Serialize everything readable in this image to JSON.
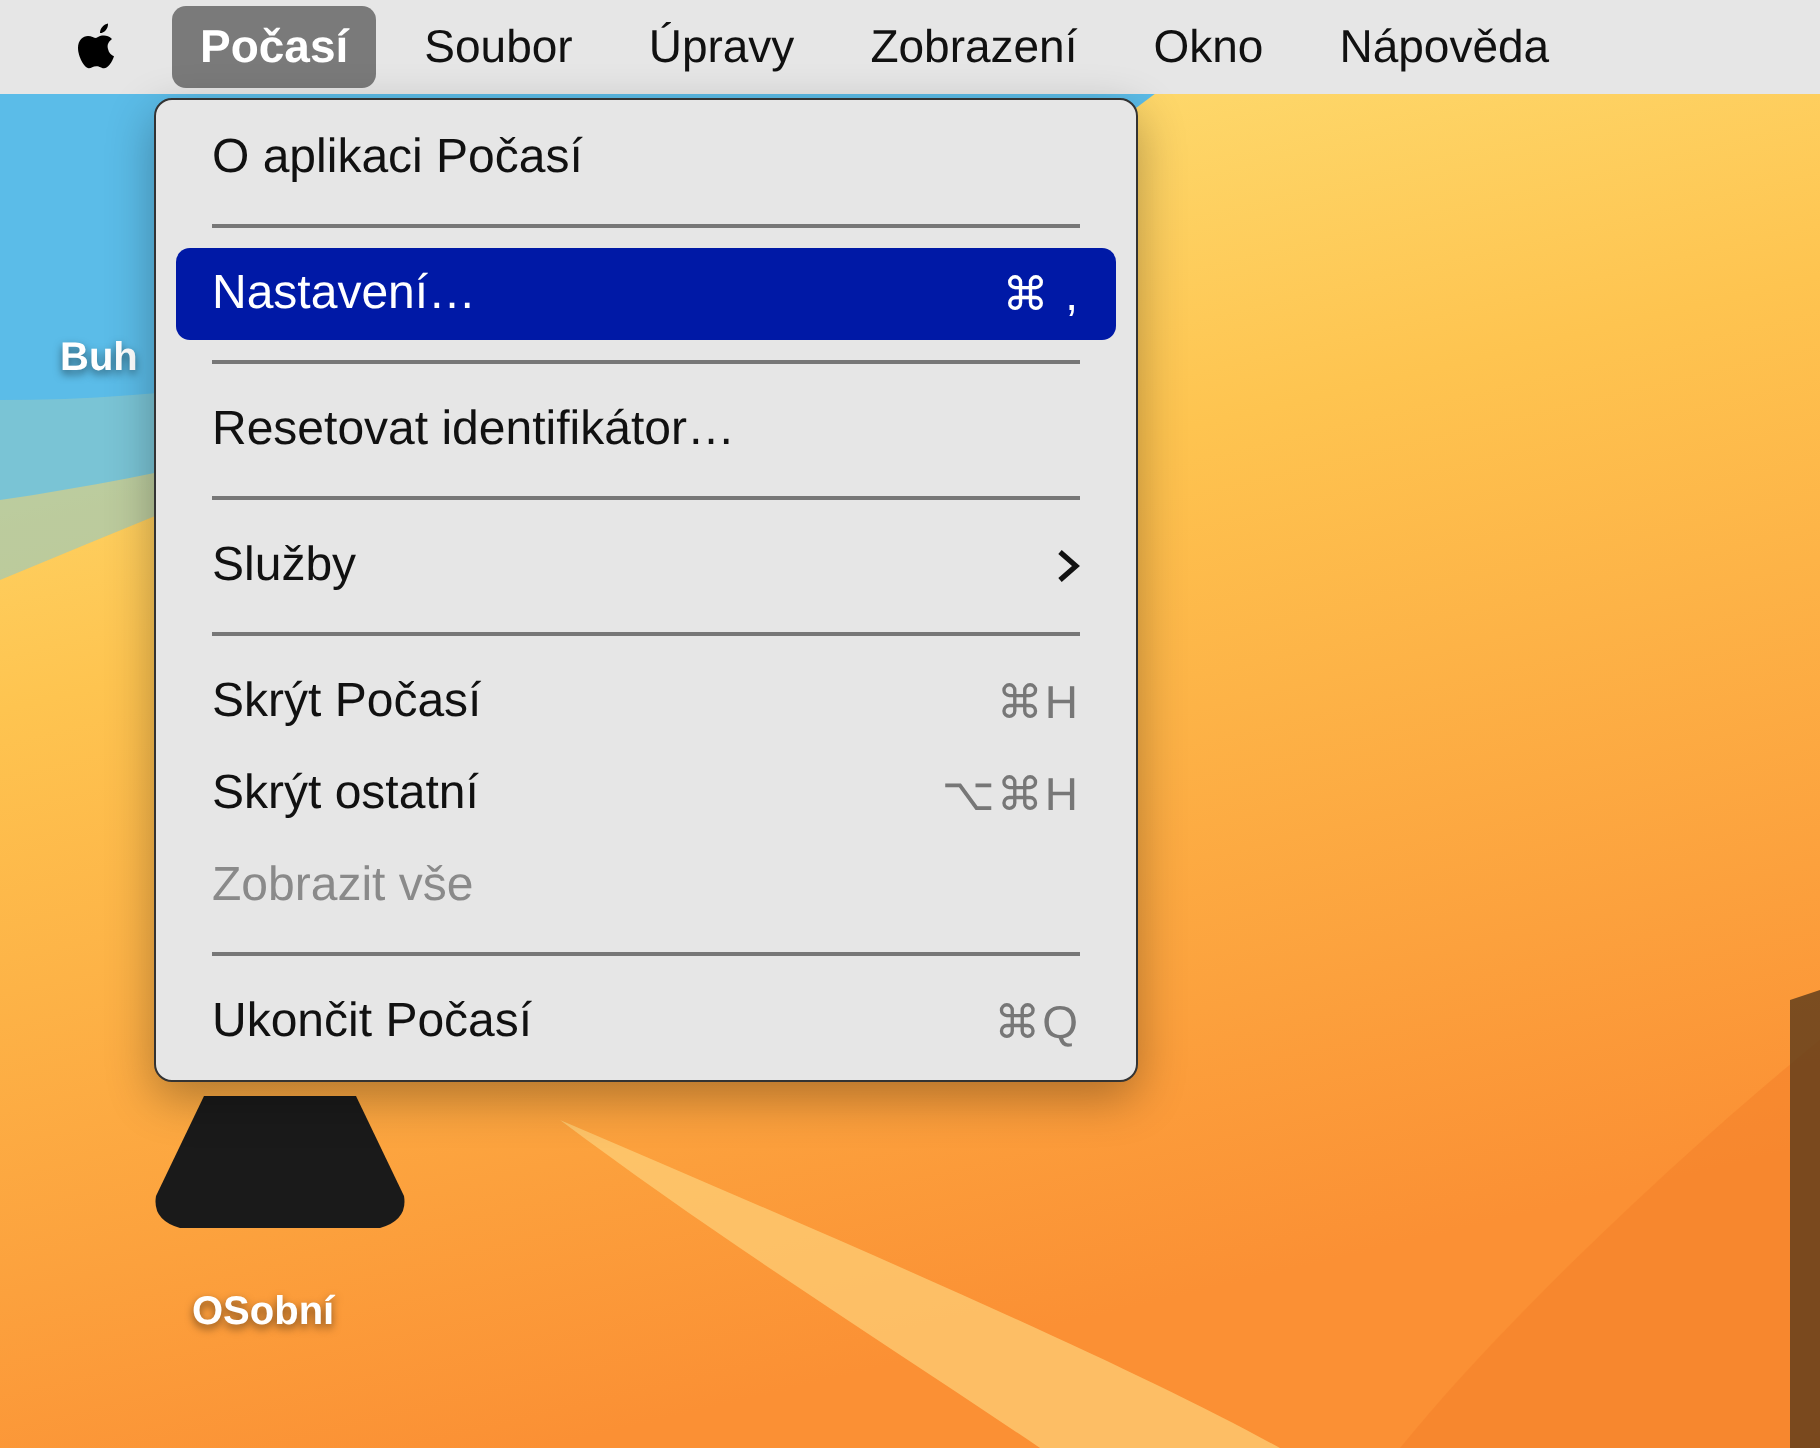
{
  "menu_bar": {
    "items": [
      {
        "label": "Počasí",
        "selected": true
      },
      {
        "label": "Soubor",
        "selected": false
      },
      {
        "label": "Úpravy",
        "selected": false
      },
      {
        "label": "Zobrazení",
        "selected": false
      },
      {
        "label": "Okno",
        "selected": false
      },
      {
        "label": "Nápověda",
        "selected": false
      }
    ]
  },
  "menu": {
    "items": [
      {
        "kind": "item",
        "label": "O aplikaci Počasí",
        "disabled": false,
        "selected": false
      },
      {
        "kind": "separator"
      },
      {
        "kind": "item",
        "label": "Nastavení…",
        "shortcut": "⌘ ,",
        "disabled": false,
        "selected": true
      },
      {
        "kind": "separator"
      },
      {
        "kind": "item",
        "label": "Resetovat identifikátor…",
        "disabled": false,
        "selected": false
      },
      {
        "kind": "separator"
      },
      {
        "kind": "submenu",
        "label": "Služby",
        "disabled": false,
        "selected": false
      },
      {
        "kind": "separator"
      },
      {
        "kind": "item",
        "label": "Skrýt Počasí",
        "shortcut": "⌘H",
        "disabled": false,
        "selected": false
      },
      {
        "kind": "item",
        "label": "Skrýt ostatní",
        "shortcut": "⌥⌘H",
        "disabled": false,
        "selected": false
      },
      {
        "kind": "item",
        "label": "Zobrazit vše",
        "disabled": true,
        "selected": false
      },
      {
        "kind": "separator"
      },
      {
        "kind": "item",
        "label": "Ukončit Počasí",
        "shortcut": "⌘Q",
        "disabled": false,
        "selected": false
      }
    ]
  },
  "desktop_icons": [
    {
      "label": "Buh"
    },
    {
      "label": "OSobní"
    }
  ]
}
